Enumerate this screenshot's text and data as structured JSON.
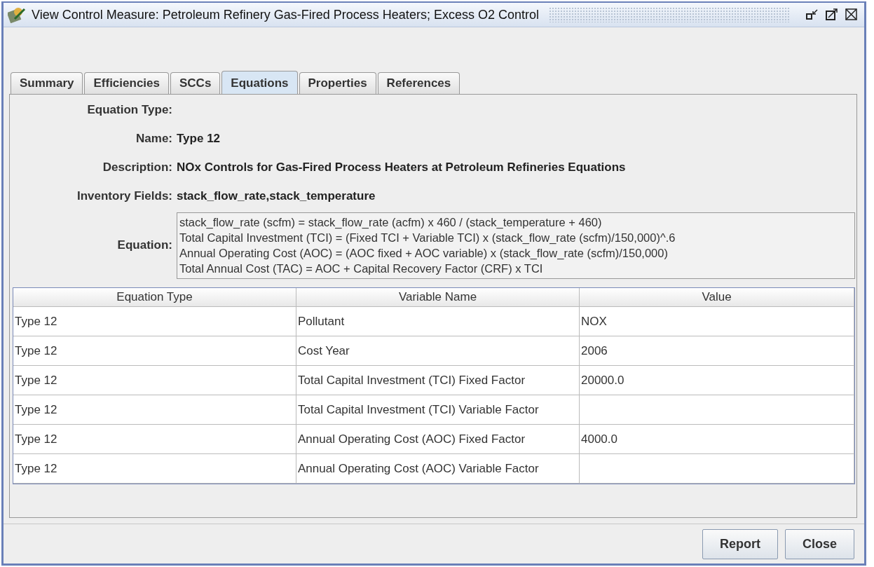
{
  "window": {
    "title": "View Control Measure: Petroleum Refinery Gas-Fired Process Heaters; Excess O2 Control"
  },
  "tabs": [
    {
      "label": "Summary",
      "selected": false
    },
    {
      "label": "Efficiencies",
      "selected": false
    },
    {
      "label": "SCCs",
      "selected": false
    },
    {
      "label": "Equations",
      "selected": true
    },
    {
      "label": "Properties",
      "selected": false
    },
    {
      "label": "References",
      "selected": false
    }
  ],
  "fields": [
    {
      "label": "Equation Type:"
    },
    {
      "label": "Name:",
      "value": "Type 12"
    },
    {
      "label": "Description:",
      "value": "NOx Controls for Gas-Fired Process Heaters at Petroleum Refineries Equations"
    },
    {
      "label": "Inventory Fields:",
      "value": "stack_flow_rate,stack_temperature"
    }
  ],
  "equation": {
    "label": "Equation:",
    "lines": [
      "stack_flow_rate (scfm) = stack_flow_rate (acfm) x 460 / (stack_temperature + 460)",
      "Total Capital Investment (TCI) = (Fixed TCI + Variable TCI) x (stack_flow_rate (scfm)/150,000)^.6",
      "Annual Operating Cost (AOC) = (AOC fixed + AOC variable) x (stack_flow_rate (scfm)/150,000)",
      "Total Annual Cost (TAC) = AOC + Capital Recovery Factor (CRF) x TCI"
    ]
  },
  "table": {
    "columns": [
      "Equation Type",
      "Variable Name",
      "Value"
    ],
    "rows": [
      [
        "Type 12",
        "Pollutant",
        "NOX"
      ],
      [
        "Type 12",
        "Cost Year",
        "2006"
      ],
      [
        "Type 12",
        "Total Capital Investment (TCI) Fixed Factor",
        "20000.0"
      ],
      [
        "Type 12",
        "Total Capital Investment (TCI) Variable Factor",
        ""
      ],
      [
        "Type 12",
        "Annual Operating Cost (AOC) Fixed Factor",
        "4000.0"
      ],
      [
        "Type 12",
        "Annual Operating Cost (AOC) Variable Factor",
        ""
      ]
    ]
  },
  "buttons": [
    "Report",
    "Close"
  ]
}
